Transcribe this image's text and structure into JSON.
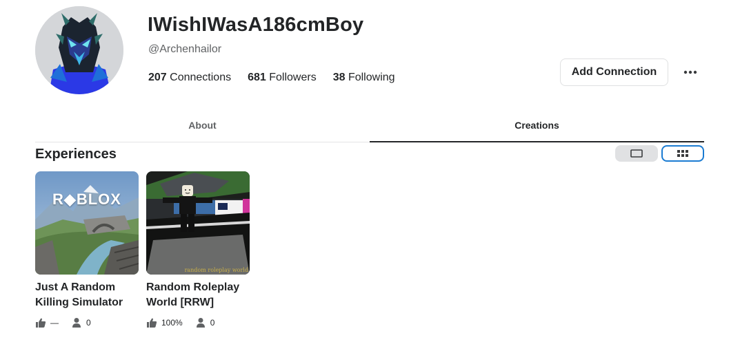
{
  "profile": {
    "display_name": "IWishIWasA186cmBoy",
    "username": "@Archenhailor",
    "avatar_icon": "avatar-headshot-icon"
  },
  "stats": [
    {
      "count": "207",
      "label": "Connections"
    },
    {
      "count": "681",
      "label": "Followers"
    },
    {
      "count": "38",
      "label": "Following"
    }
  ],
  "actions": {
    "add_connection_label": "Add Connection",
    "more_icon": "more-horizontal-icon"
  },
  "tabs": [
    {
      "label": "About",
      "active": false
    },
    {
      "label": "Creations",
      "active": true
    }
  ],
  "section": {
    "title": "Experiences",
    "view_single_icon": "single-view-icon",
    "view_grid_icon": "grid-view-icon"
  },
  "experiences": [
    {
      "title_line1": "Just A Random",
      "title_line2": "Killing Simulator",
      "thumbnail_logo": "R◆BLOX",
      "rating": "—",
      "players": "0",
      "rating_icon": "thumbs-up-icon",
      "players_icon": "player-icon"
    },
    {
      "title_line1": "Random Roleplay",
      "title_line2": "World [RRW]",
      "thumbnail_caption": "random roleplay world",
      "rating": "100%",
      "players": "0",
      "rating_icon": "thumbs-up-icon",
      "players_icon": "player-icon"
    }
  ],
  "colors": {
    "accent_blue": "#1a7bd2",
    "text_primary": "#232527",
    "text_secondary": "#606264"
  }
}
